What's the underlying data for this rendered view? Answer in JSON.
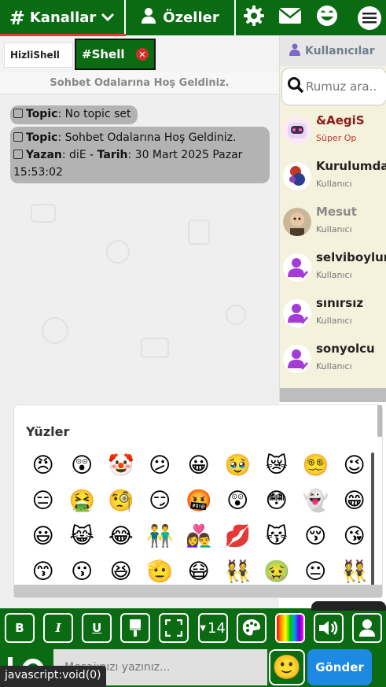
{
  "topbar": {
    "channels_label": "Kanallar",
    "privates_label": "Özeller",
    "icons": [
      "gear-icon",
      "mail-icon",
      "laughing-face-icon",
      "hamburger-menu-icon"
    ]
  },
  "tabs": {
    "items": [
      {
        "label": "HizliShell",
        "active": false
      },
      {
        "label": "#Shell",
        "active": true
      }
    ],
    "close_glyph": "✕"
  },
  "welcome_text": "Sohbet Odalarına Hoş Geldiniz.",
  "messages": [
    {
      "topic_label": "Topic",
      "topic_text": ": No topic set"
    },
    {
      "topic_label": "Topic",
      "topic_text": ": Sohbet Odalarına Hoş Geldiniz.",
      "author_label": "Yazan",
      "author_value": ": diE - ",
      "date_label": "Tarih",
      "date_value": ": 30 Mart 2025 Pazar 15:53:02"
    }
  ],
  "users_panel": {
    "title": "Kullanıcılar",
    "search_placeholder": "Rumuz ara..",
    "users": [
      {
        "name": "&AegiS",
        "role": "Süper Op",
        "name_color": "#8b1a1a",
        "role_color": "#c0392b"
      },
      {
        "name": "Kurulumda",
        "role": "Kullanıcı",
        "name_color": "#222222",
        "role_color": "#777777"
      },
      {
        "name": "Mesut",
        "role": "Kullanıcı",
        "name_color": "#8a8a8a",
        "role_color": "#777777"
      },
      {
        "name": "selviboylum",
        "role": "Kullanıcı",
        "name_color": "#222222",
        "role_color": "#777777"
      },
      {
        "name": "sınırsız",
        "role": "Kullanıcı",
        "name_color": "#222222",
        "role_color": "#777777"
      },
      {
        "name": "sonyolcu",
        "role": "Kullanıcı",
        "name_color": "#222222",
        "role_color": "#777777"
      }
    ]
  },
  "emoji_panel": {
    "title": "Yüzler",
    "rows": [
      [
        "😠",
        "😲",
        "🤡",
        "😕",
        "😀",
        "🥹",
        "😿",
        "😵‍💫",
        "😉"
      ],
      [
        "😑",
        "🤮",
        "🧐",
        "😏",
        "🤬",
        "😲",
        "😳",
        "👻",
        "😁"
      ],
      [
        "😃",
        "😹",
        "😂",
        "👬",
        "👩‍❤️‍👨",
        "💋",
        "😽",
        "😚",
        "😘"
      ],
      [
        "😙",
        "😗",
        "😆",
        "🫡",
        "😷",
        "👯",
        "🤢",
        "😐",
        "👯"
      ]
    ]
  },
  "toolbar": {
    "bold": "B",
    "italic": "I",
    "underline": "U",
    "font_size": "14"
  },
  "composer": {
    "placeholder": "Mesajınızı yazınız...",
    "send_label": "Gönder",
    "emoji_button": "🙂"
  },
  "status_bar": "javascript:void(0)",
  "colors": {
    "brand_green": "#0b6b12",
    "send_blue": "#1e88e5",
    "close_red": "#d32f2f",
    "bubble_gray": "#b3b3b3"
  }
}
